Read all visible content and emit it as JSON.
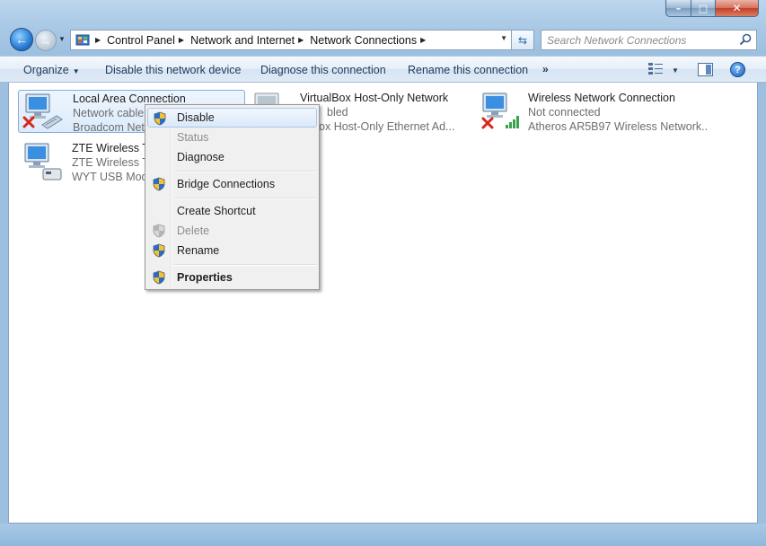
{
  "window": {
    "caption": {
      "minimize": "–",
      "maximize": "□",
      "close": "✕"
    }
  },
  "address": {
    "crumbs": [
      "Control Panel",
      "Network and Internet",
      "Network Connections"
    ],
    "search_placeholder": "Search Network Connections"
  },
  "cmdbar": {
    "organize": "Organize",
    "disable": "Disable this network device",
    "diagnose": "Diagnose this connection",
    "rename": "Rename this connection",
    "more": "»",
    "help": "?"
  },
  "connections": [
    {
      "name": "Local Area Connection",
      "status": "Network cable u",
      "device": "Broadcom NetL",
      "icon": "wired-network-icon",
      "state_icon": "disconnected-x-icon"
    },
    {
      "name": "VirtualBox Host-Only Network",
      "status": "bled",
      "device": "ualBox Host-Only Ethernet Ad...",
      "icon": "wired-network-icon"
    },
    {
      "name": "Wireless Network Connection",
      "status": "Not connected",
      "device": "Atheros AR5B97 Wireless Network...",
      "icon": "wireless-network-icon",
      "state_icon": "disconnected-x-icon"
    },
    {
      "name": "ZTE Wireless Te",
      "status": "ZTE Wireless Te",
      "device": "WYT USB Mode",
      "icon": "modem-network-icon"
    }
  ],
  "context_menu": {
    "items": [
      {
        "label": "Disable",
        "shield": true,
        "highlighted": true
      },
      {
        "label": "Status",
        "disabled": true
      },
      {
        "label": "Diagnose"
      },
      {
        "label": "Bridge Connections",
        "shield": true
      },
      {
        "label": "Create Shortcut"
      },
      {
        "label": "Delete",
        "shield": true,
        "disabled": true
      },
      {
        "label": "Rename",
        "shield": true
      },
      {
        "label": "Properties",
        "shield": true,
        "bold": true
      }
    ]
  },
  "colors": {
    "accent": "#1e395b",
    "selection": "#dcebfc",
    "disconnect_x": "#d9261c",
    "signal_green": "#3aa34a"
  }
}
